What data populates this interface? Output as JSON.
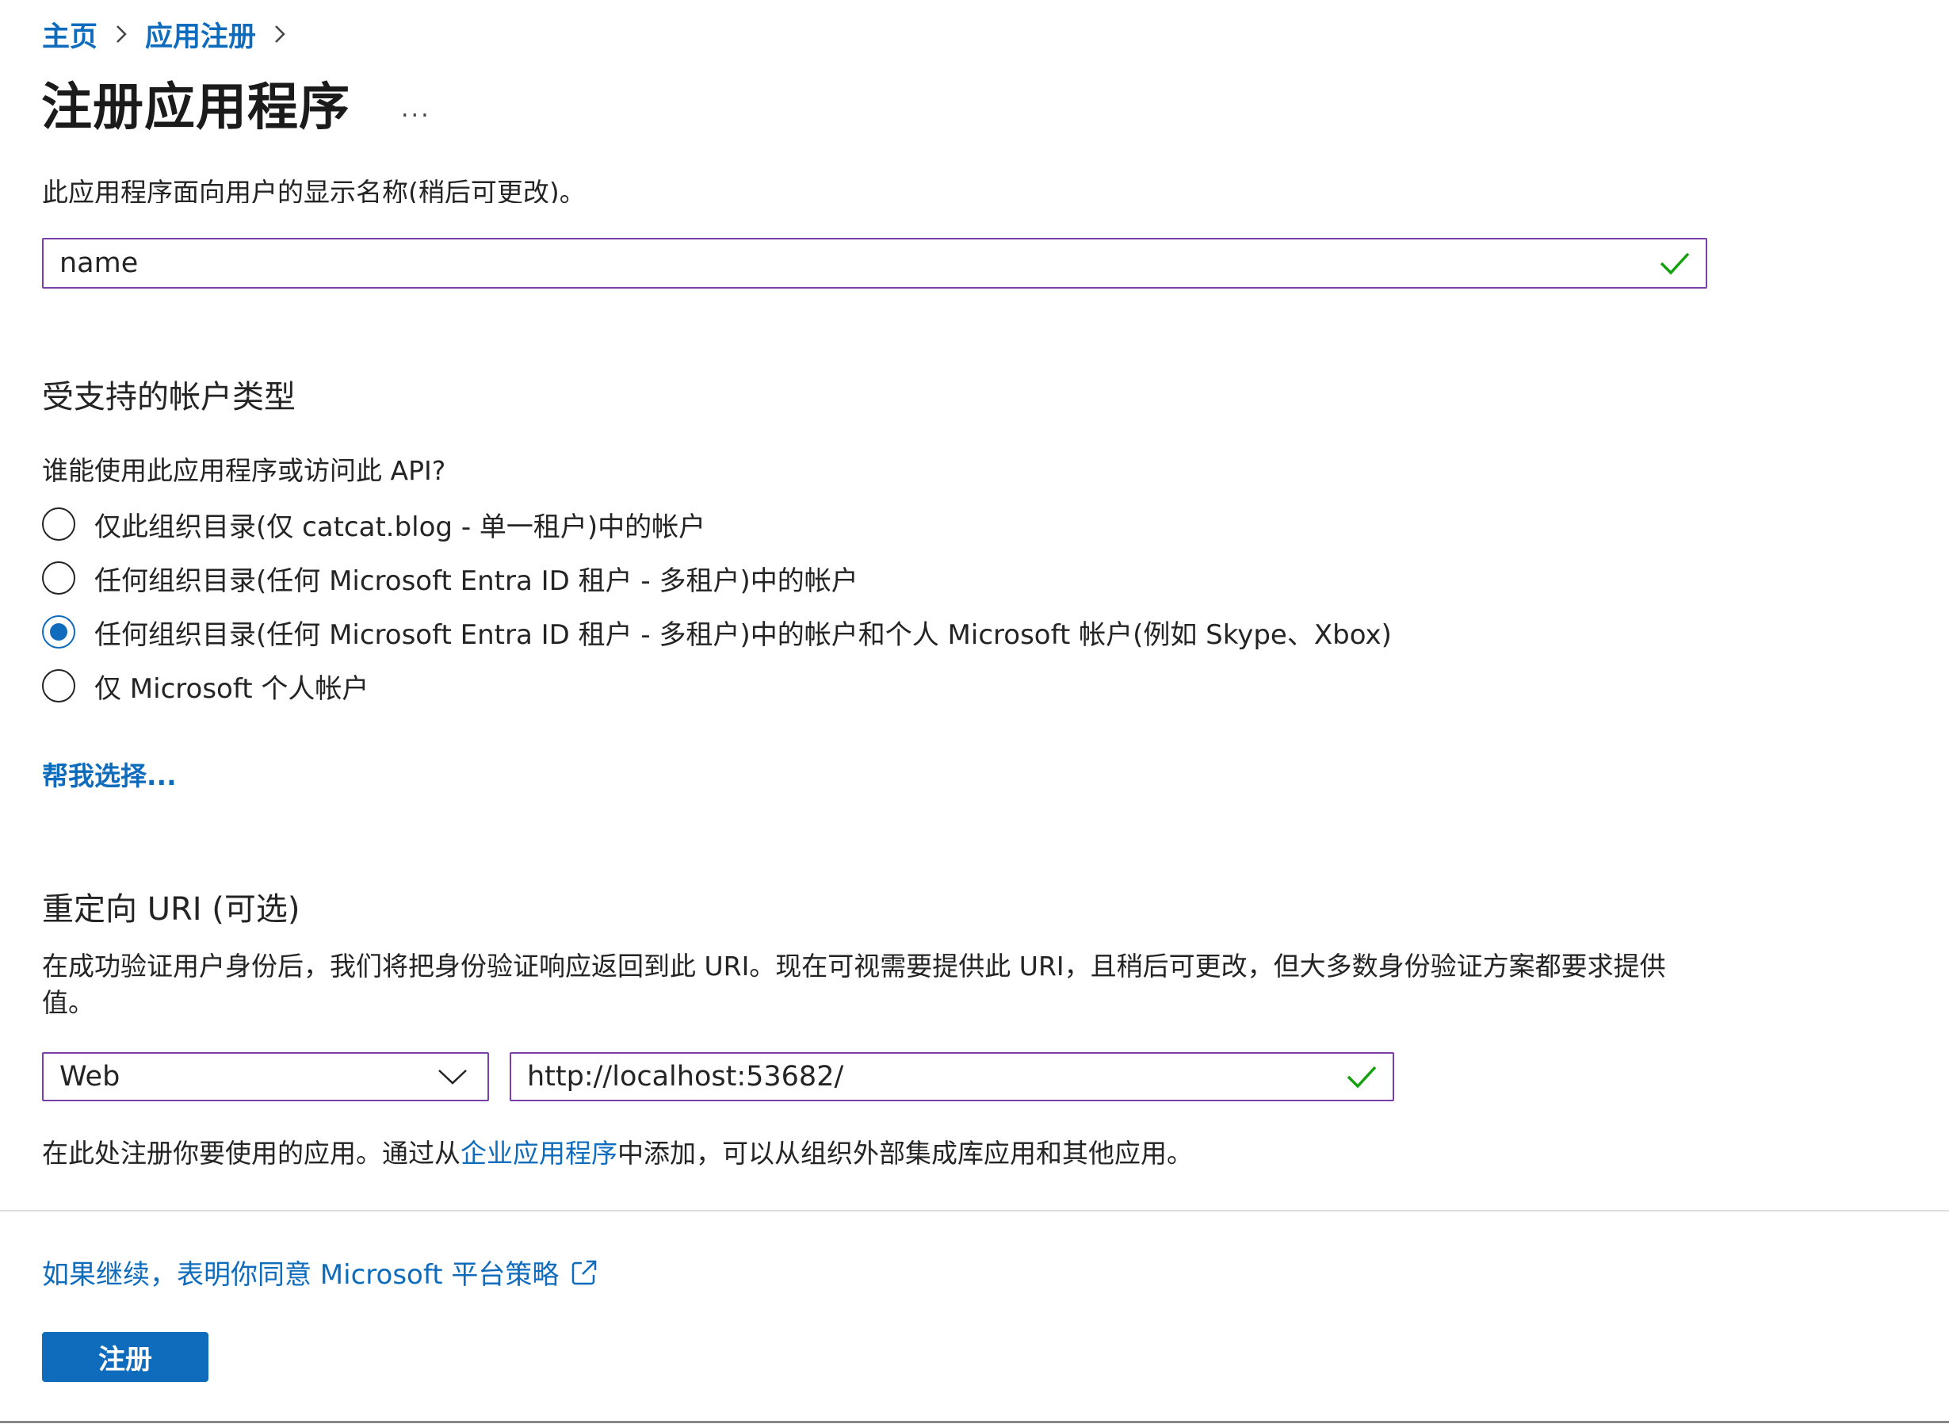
{
  "breadcrumb": {
    "items": [
      "主页",
      "应用注册"
    ]
  },
  "title": "注册应用程序",
  "more_label": "...",
  "name_section": {
    "cropped_hint": "此应用程序面向用户的显示名称(稍后可更改)。",
    "value": "name"
  },
  "account_types": {
    "heading": "受支持的帐户类型",
    "question": "谁能使用此应用程序或访问此 API?",
    "options": [
      {
        "label": "仅此组织目录(仅 catcat.blog - 单一租户)中的帐户",
        "checked": false
      },
      {
        "label": "任何组织目录(任何 Microsoft Entra ID 租户 - 多租户)中的帐户",
        "checked": false
      },
      {
        "label": "任何组织目录(任何 Microsoft Entra ID 租户 - 多租户)中的帐户和个人 Microsoft 帐户(例如 Skype、Xbox)",
        "checked": true
      },
      {
        "label": "仅 Microsoft 个人帐户",
        "checked": false
      }
    ],
    "help_link": "帮我选择..."
  },
  "redirect": {
    "heading": "重定向 URI (可选)",
    "description": "在成功验证用户身份后，我们将把身份验证响应返回到此 URI。现在可视需要提供此 URI，且稍后可更改，但大多数身份验证方案都要求提供值。",
    "platform": "Web",
    "uri": "http://localhost:53682/"
  },
  "register_note": {
    "prefix": "在此处注册你要使用的应用。通过从",
    "link": "企业应用程序",
    "suffix": "中添加，可以从组织外部集成库应用和其他应用。"
  },
  "policy_link": "如果继续，表明你同意 Microsoft 平台策略",
  "register_button": "注册",
  "colors": {
    "accent": "#0f6cbd",
    "focus_border": "#7a3fa8",
    "valid_check": "#13a10e"
  }
}
